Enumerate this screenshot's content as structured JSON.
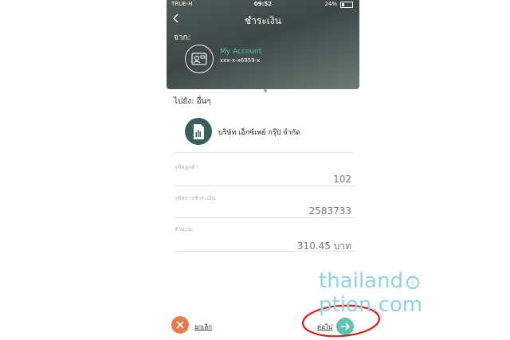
{
  "status": {
    "carrier": "TRUE-H",
    "time": "09:52",
    "battery": "24%"
  },
  "header": {
    "title": "ชำระเงิน",
    "back_icon": "chevron-left-icon"
  },
  "from": {
    "label": "จาก:",
    "account_name": "My Account",
    "account_number": "xxx-x-x6959-x",
    "icon": "account-card-icon"
  },
  "to": {
    "label": "ไปยัง: อื่นๆ",
    "biller_name": "บริษัท เอ็กซ์เพย์ กรุ๊ป จำกัด",
    "icon": "bill-document-icon"
  },
  "fields": [
    {
      "label": "รหัสลูกค้า",
      "value": "102"
    },
    {
      "label": "รหัสการชำระเงิน",
      "value": "2583733"
    },
    {
      "label": "จำนวน:",
      "value": "310.45 บาท"
    }
  ],
  "actions": {
    "cancel_label": "ยกเลิก",
    "next_label": "ต่อไป"
  },
  "watermark": {
    "left": "thailand",
    "right": "ption.com"
  },
  "colors": {
    "accent": "#5cc4b0",
    "cancel": "#ea7a4a",
    "header": "#3d4746",
    "annotation": "#e0201c"
  }
}
